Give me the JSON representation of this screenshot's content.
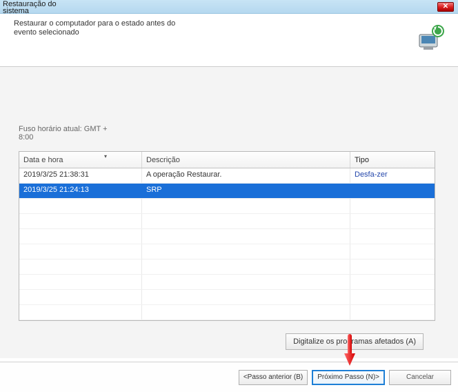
{
  "titlebar": {
    "title_line1": "Restauração do",
    "title_line2": "sistema"
  },
  "header": {
    "subtitle": "Restaurar o computador para o estado antes do evento selecionado"
  },
  "body": {
    "timezone": "Fuso horário atual: GMT + 8:00"
  },
  "table": {
    "headers": {
      "datetime": "Data e hora",
      "description": "Descrição",
      "type": "Tipo"
    },
    "rows": [
      {
        "datetime": "2019/3/25 21:38:31",
        "description": "A operação Restaurar.",
        "type": "Desfa-zer",
        "selected": false
      },
      {
        "datetime": "2019/3/25 21:24:13",
        "description": "SRP",
        "type": "",
        "selected": true
      }
    ]
  },
  "buttons": {
    "scan": "Digitalize os programas afetados (A)",
    "prev": "<Passo anterior (B)",
    "next": "Próximo Passo (N)>",
    "cancel": "Cancelar"
  }
}
